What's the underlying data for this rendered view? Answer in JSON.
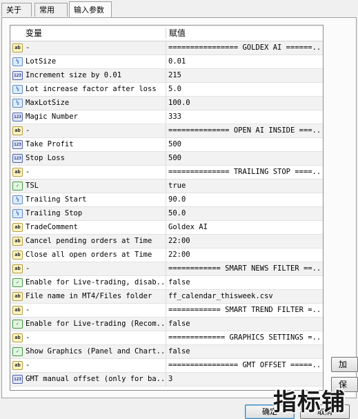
{
  "tabs": [
    {
      "label": "关于"
    },
    {
      "label": "常用"
    },
    {
      "label": "输入参数"
    }
  ],
  "grid": {
    "columns": {
      "variable": "变量",
      "value": "赋值"
    },
    "rows": [
      {
        "icon": "ab",
        "name": "-",
        "value": "================ GOLDEX AI ======..."
      },
      {
        "icon": "v2",
        "name": "LotSize",
        "value": "0.01"
      },
      {
        "icon": "123",
        "name": "Increment size by 0.01",
        "value": "215"
      },
      {
        "icon": "v2",
        "name": "Lot increase factor after loss",
        "value": "5.0"
      },
      {
        "icon": "v2",
        "name": "MaxLotSize",
        "value": "100.0"
      },
      {
        "icon": "123",
        "name": "Magic Number",
        "value": "333"
      },
      {
        "icon": "ab",
        "name": "-",
        "value": "============== OPEN AI INSIDE ===..."
      },
      {
        "icon": "123",
        "name": "Take Profit",
        "value": "500"
      },
      {
        "icon": "123",
        "name": "Stop Loss",
        "value": "500"
      },
      {
        "icon": "ab",
        "name": "-",
        "value": "============== TRAILING STOP ====..."
      },
      {
        "icon": "tf",
        "name": "TSL",
        "value": "true"
      },
      {
        "icon": "v2",
        "name": "Trailing Start",
        "value": "90.0"
      },
      {
        "icon": "v2",
        "name": "Trailing Stop",
        "value": "50.0"
      },
      {
        "icon": "ab",
        "name": "TradeComment",
        "value": "Goldex AI"
      },
      {
        "icon": "ab",
        "name": "Cancel pending orders at Time",
        "value": "22:00"
      },
      {
        "icon": "ab",
        "name": "Close all open orders at Time",
        "value": "22:00"
      },
      {
        "icon": "ab",
        "name": "-",
        "value": "============ SMART NEWS FILTER ==..."
      },
      {
        "icon": "tf",
        "name": "Enable for Live-trading, disab...",
        "value": "false"
      },
      {
        "icon": "ab",
        "name": "File name in MT4/Files folder",
        "value": "ff_calendar_thisweek.csv"
      },
      {
        "icon": "ab",
        "name": "-",
        "value": "============ SMART TREND FILTER =..."
      },
      {
        "icon": "tf",
        "name": "Enable for Live-trading (Recom...",
        "value": "false"
      },
      {
        "icon": "ab",
        "name": "-",
        "value": "============= GRAPHICS SETTINGS =..."
      },
      {
        "icon": "tf",
        "name": "Show Graphics (Panel and Chart...",
        "value": "false"
      },
      {
        "icon": "ab",
        "name": "-",
        "value": "================ GMT OFFSET =====..."
      },
      {
        "icon": "123",
        "name": "GMT manual offset (only for ba...",
        "value": "3"
      }
    ]
  },
  "side_buttons": {
    "load": "加",
    "save": "保"
  },
  "bottom_buttons": {
    "ok": "确定",
    "cancel": "取消"
  },
  "watermark": "指标铺",
  "icon_types": {
    "ab": "string-param-icon",
    "v2": "double-param-icon",
    "123": "integer-param-icon",
    "tf": "bool-param-icon"
  }
}
